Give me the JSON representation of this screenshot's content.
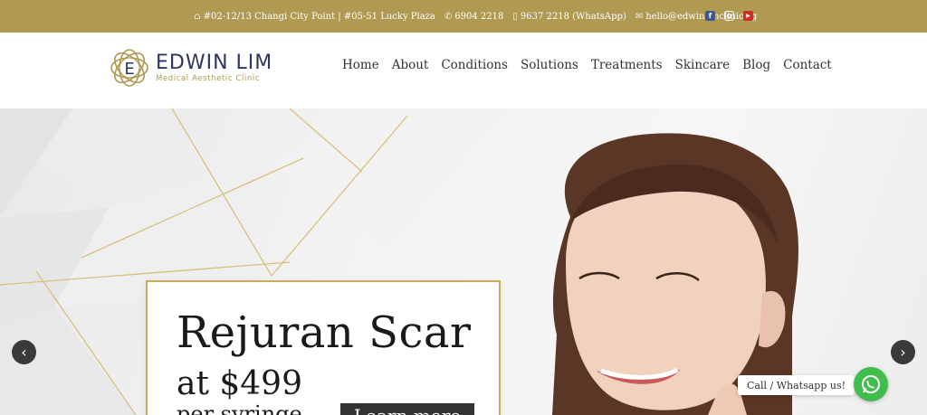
{
  "topbar": {
    "address": "#02-12/13 Changi City Point | #05-51 Lucky Plaza",
    "phone": "6904 2218",
    "whatsapp": "9637 2218 (WhatsApp)",
    "email": "hello@edwinlimclinic.sg",
    "icons": [
      "home-icon",
      "phone-icon",
      "mobile-icon",
      "mail-icon",
      "facebook-icon",
      "instagram-icon",
      "youtube-icon"
    ],
    "facebook_glyph": "f",
    "youtube_glyph": "▶"
  },
  "brand": {
    "letter": "E",
    "name": "EDWIN LIM",
    "tagline": "Medical Aesthetic Clinic",
    "gold": "#b09a52",
    "navy": "#2d3560"
  },
  "nav": {
    "items": [
      "Home",
      "About",
      "Conditions",
      "Solutions",
      "Treatments",
      "Skincare",
      "Blog",
      "Contact"
    ]
  },
  "hero": {
    "title": "Rejuran Scar",
    "price": "at $499",
    "sub": "per syringe",
    "cta": "Learn more",
    "prev_glyph": "‹",
    "next_glyph": "›"
  },
  "contact_widget": {
    "label": "Call / Whatsapp us!",
    "icon": "whatsapp-icon",
    "color": "#3fbe4d"
  }
}
